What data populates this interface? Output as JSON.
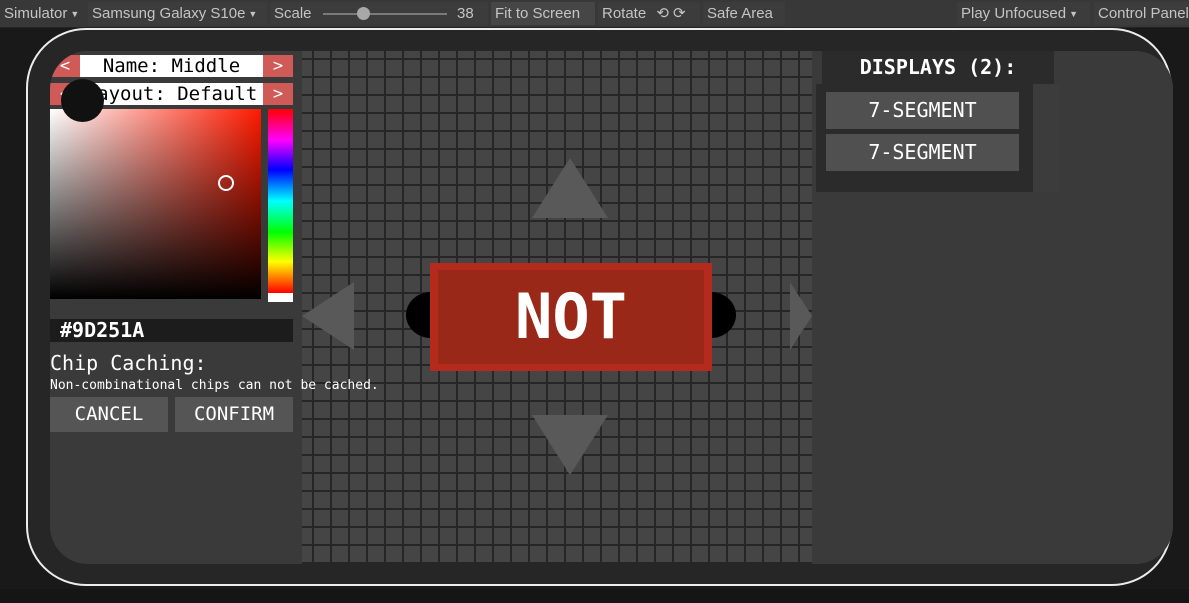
{
  "toolbar": {
    "simulator_label": "Simulator",
    "device_label": "Samsung Galaxy S10e",
    "scale_label": "Scale",
    "scale_value": "38",
    "fit_label": "Fit to Screen",
    "rotate_label": "Rotate",
    "safe_area_label": "Safe Area",
    "play_mode_label": "Play Unfocused",
    "control_panel_label": "Control Panel"
  },
  "chip_editor": {
    "name_prev": "<",
    "name_label": "Name: Middle",
    "name_next": ">",
    "layout_prev": "<",
    "layout_label": "Layout: Default",
    "layout_next": ">",
    "hex_value": "#9D251A",
    "caching_title": "Chip Caching:",
    "caching_note": "Non-combinational chips can not be cached.",
    "cancel_label": "CANCEL",
    "confirm_label": "CONFIRM"
  },
  "chip": {
    "label": "NOT",
    "color": "#9D251A"
  },
  "displays": {
    "title": "DISPLAYS (2):",
    "items": [
      "7-SEGMENT",
      "7-SEGMENT"
    ]
  },
  "colors": {
    "accent": "#cf5a58"
  }
}
